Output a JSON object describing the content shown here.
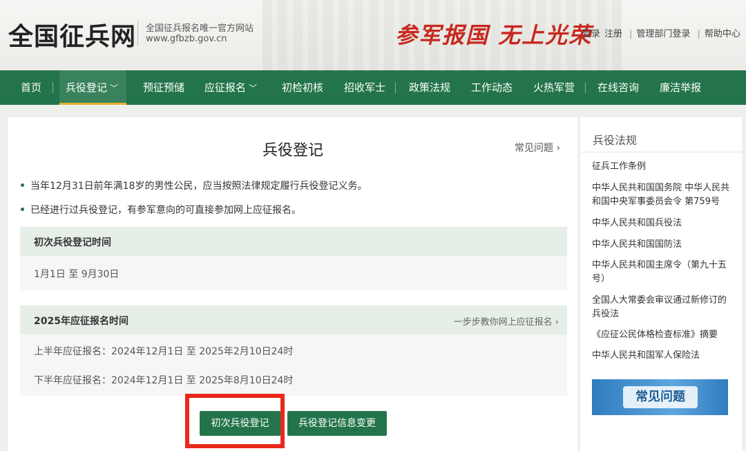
{
  "header": {
    "site_title": "全国征兵网",
    "site_subtitle": "全国征兵报名唯一官方网站",
    "site_url": "www.gfbzb.gov.cn",
    "slogan": "参军报国 无上光荣",
    "links": {
      "login": "登录",
      "register": "注册",
      "admin_login": "管理部门登录",
      "help": "帮助中心"
    }
  },
  "nav": {
    "items": [
      {
        "label": "首页"
      },
      {
        "label": "兵役登记"
      },
      {
        "label": "预征预储"
      },
      {
        "label": "应征报名"
      },
      {
        "label": "初检初核"
      },
      {
        "label": "招收军士"
      },
      {
        "label": "政策法规"
      },
      {
        "label": "工作动态"
      },
      {
        "label": "火热军营"
      },
      {
        "label": "在线咨询"
      },
      {
        "label": "廉洁举报"
      }
    ]
  },
  "main": {
    "title": "兵役登记",
    "faq_link": "常见问题",
    "bullets": [
      "当年12月31日前年满18岁的男性公民，应当按照法律规定履行兵役登记义务。",
      "已经进行过兵役登记，有参军意向的可直接参加网上应征报名。"
    ],
    "first_reg": {
      "title": "初次兵役登记时间",
      "range": "1月1日 至 9月30日"
    },
    "enlist": {
      "title": "2025年应征报名时间",
      "guide_link": "一步步教你网上应征报名",
      "first_half": "上半年应征报名：2024年12月1日 至 2025年2月10日24时",
      "second_half": "下半年应征报名：2024年12月1日 至 2025年8月10日24时"
    },
    "buttons": {
      "first_register": "初次兵役登记",
      "info_change": "兵役登记信息变更"
    }
  },
  "sidebar": {
    "title": "兵役法规",
    "items": [
      "征兵工作条例",
      "中华人民共和国国务院 中华人民共和国中央军事委员会令 第759号",
      "中华人民共和国兵役法",
      "中华人民共和国国防法",
      "中华人民共和国主席令（第九十五号）",
      "全国人大常委会审议通过新修订的兵役法",
      "《应征公民体格检查标准》摘要",
      "中华人民共和国军人保险法"
    ],
    "banner_text": "常见问题"
  },
  "colors": {
    "nav_green": "#23744a",
    "accent_gold": "#e8b230",
    "highlight_red": "#e8291b",
    "slogan_red": "#c8281e"
  }
}
